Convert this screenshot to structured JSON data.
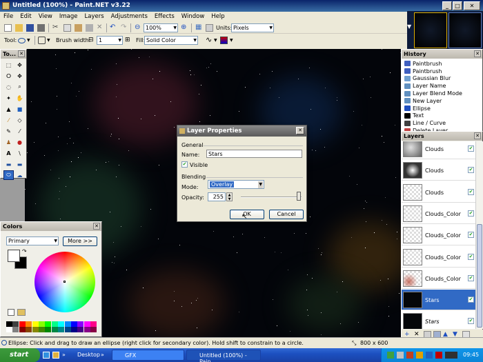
{
  "window": {
    "title": "Untitled (100%) - Paint.NET v3.22"
  },
  "menu": [
    "File",
    "Edit",
    "View",
    "Image",
    "Layers",
    "Adjustments",
    "Effects",
    "Window",
    "Help"
  ],
  "toolbar": {
    "zoom": "100%",
    "units_label": "Units:",
    "units": "Pixels"
  },
  "toolbar2": {
    "tool_label": "Tool:",
    "brush_width_label": "Brush width:",
    "brush_width": "1",
    "fill_label": "Fill:",
    "fill": "Solid Color"
  },
  "tools_panel": {
    "title": "To..."
  },
  "colors_panel": {
    "title": "Colors",
    "mode": "Primary",
    "more_label": "More >>"
  },
  "history_panel": {
    "title": "History",
    "items": [
      {
        "label": "Paintbrush",
        "color": "#4060c0"
      },
      {
        "label": "Paintbrush",
        "color": "#4060c0"
      },
      {
        "label": "Gaussian Blur",
        "color": "#70a0d0"
      },
      {
        "label": "Layer Name",
        "color": "#6090c0"
      },
      {
        "label": "Layer Blend Mode",
        "color": "#6090c0"
      },
      {
        "label": "New Layer",
        "color": "#6090c0"
      },
      {
        "label": "Ellipse",
        "color": "#2050c0"
      },
      {
        "label": "Text",
        "color": "#000000"
      },
      {
        "label": "Line / Curve",
        "color": "#404040"
      },
      {
        "label": "Delete Layer",
        "color": "#c04040"
      }
    ]
  },
  "layers_panel": {
    "title": "Layers",
    "layers": [
      {
        "name": "Clouds",
        "selected": false,
        "visible": true,
        "style": "clouds"
      },
      {
        "name": "Clouds",
        "selected": false,
        "visible": true,
        "style": "clouds2"
      },
      {
        "name": "Clouds",
        "selected": false,
        "visible": true,
        "style": "checker"
      },
      {
        "name": "Clouds_Color",
        "selected": false,
        "visible": true,
        "style": "checker"
      },
      {
        "name": "Clouds_Color",
        "selected": false,
        "visible": true,
        "style": "checker"
      },
      {
        "name": "Clouds_Color",
        "selected": false,
        "visible": true,
        "style": "checker"
      },
      {
        "name": "Clouds_Color",
        "selected": false,
        "visible": true,
        "style": "checkercolor"
      },
      {
        "name": "Stars",
        "selected": true,
        "visible": true,
        "style": "black"
      },
      {
        "name": "Stars",
        "selected": false,
        "visible": true,
        "style": "black",
        "italic": true
      }
    ]
  },
  "dialog": {
    "title": "Layer Properties",
    "general_label": "General",
    "name_label": "Name:",
    "name_value": "Stars",
    "visible_label": "Visible",
    "blending_label": "Blending",
    "mode_label": "Mode:",
    "mode_value": "Overlay",
    "opacity_label": "Opacity:",
    "opacity_value": "255",
    "ok_label": "OK",
    "cancel_label": "Cancel"
  },
  "status": {
    "text": "Ellipse: Click and drag to draw an ellipse (right click for secondary color). Hold shift to constrain to a circle.",
    "size": "800 x 600"
  },
  "taskbar": {
    "start": "start",
    "desktop": "Desktop",
    "tasks": [
      "GFX",
      "Untitled (100%) - Pain..."
    ],
    "time": "09:45"
  }
}
